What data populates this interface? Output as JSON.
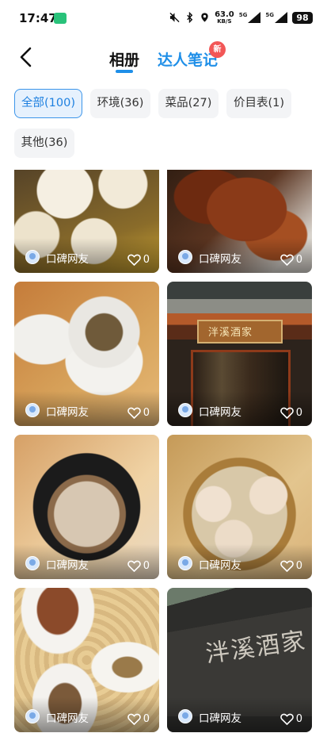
{
  "status_bar": {
    "time": "17:47",
    "app_badge": "",
    "speed_value": "63.0",
    "speed_unit": "KB/S",
    "net1": "5G",
    "net2": "5G",
    "battery": "98"
  },
  "header": {
    "tabs": [
      {
        "label": "相册",
        "active": true
      },
      {
        "label": "达人笔记",
        "active": false
      }
    ],
    "new_badge": "新",
    "accent_color": "#1f8fe8"
  },
  "filters": [
    {
      "label": "全部(100)",
      "active": true
    },
    {
      "label": "环境(36)",
      "active": false
    },
    {
      "label": "菜品(27)",
      "active": false
    },
    {
      "label": "价目表(1)",
      "active": false
    },
    {
      "label": "其他(36)",
      "active": false
    }
  ],
  "photos": [
    {
      "user": "口碑网友",
      "likes": "0",
      "image": "dumplings"
    },
    {
      "user": "口碑网友",
      "likes": "0",
      "image": "roast-goose"
    },
    {
      "user": "口碑网友",
      "likes": "0",
      "image": "tea-cup"
    },
    {
      "user": "口碑网友",
      "likes": "0",
      "image": "restaurant-entrance"
    },
    {
      "user": "口碑网友",
      "likes": "0",
      "image": "braised-taro-pot"
    },
    {
      "user": "口碑网友",
      "likes": "0",
      "image": "shrimp-dumplings-steamer"
    },
    {
      "user": "口碑网友",
      "likes": "0",
      "image": "cake-plates"
    },
    {
      "user": "口碑网友",
      "likes": "0",
      "image": "restaurant-sign"
    }
  ],
  "sign_text": "泮溪酒家",
  "front_text": "泮溪酒家"
}
